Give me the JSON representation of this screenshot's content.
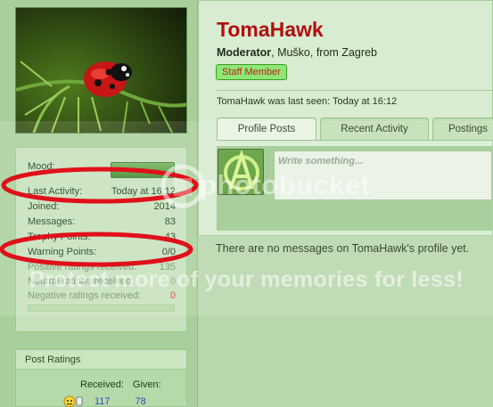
{
  "profile": {
    "username": "TomaHawk",
    "title_role": "Moderator",
    "title_rest": ", Muško, from Zagreb",
    "badge": "Staff Member",
    "last_seen": "TomaHawk was last seen: Today at 16:12"
  },
  "tabs": [
    "Profile Posts",
    "Recent Activity",
    "Postings"
  ],
  "status": {
    "placeholder": "Write something..."
  },
  "empty_message": "There are no messages on TomaHawk's profile yet.",
  "stats": {
    "mood_label": "Mood:",
    "rows": [
      {
        "label": "Last Activity:",
        "value": "Today at 16:12"
      },
      {
        "label": "Joined:",
        "value": "2014"
      },
      {
        "label": "Messages:",
        "value": "83"
      },
      {
        "label": "Trophy Points:",
        "value": "43"
      },
      {
        "label": "Warning Points:",
        "value": "0/0"
      },
      {
        "label": "Positive ratings received:",
        "value": "135"
      },
      {
        "label": "Neutral ratings received:",
        "value": "0"
      },
      {
        "label": "Negative ratings received:",
        "value": "0"
      }
    ]
  },
  "post_ratings": {
    "title": "Post Ratings",
    "received_label": "Received:",
    "given_label": "Given:",
    "received": "117",
    "given": "78"
  },
  "watermark": {
    "brand": "photobucket",
    "tagline": "Protect more of your memories for less!"
  },
  "colors": {
    "username": "#b20f0f",
    "highlight_ellipse": "#e0101a",
    "badge_bg": "#8ee774",
    "badge_text": "#c21c13",
    "numbers_blue": "#2b4fc0"
  }
}
